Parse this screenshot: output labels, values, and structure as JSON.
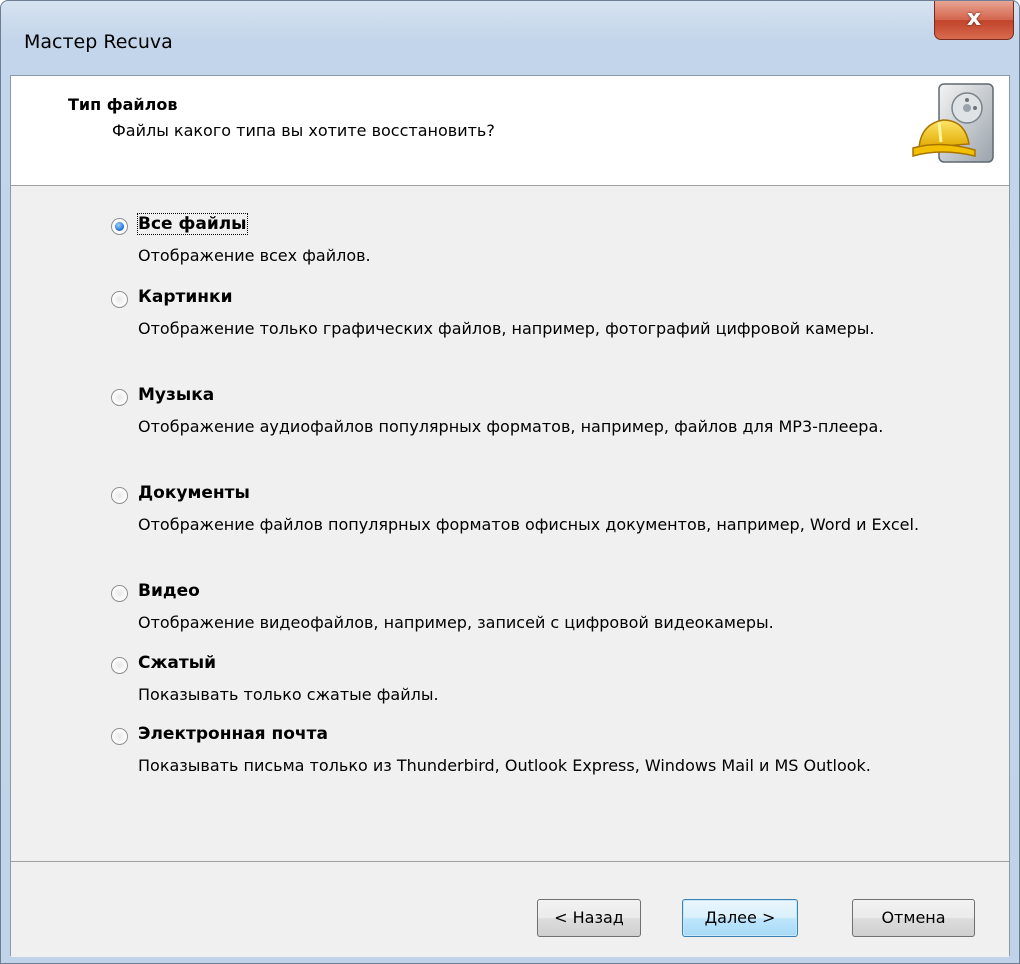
{
  "window": {
    "title": "Мастер Recuva",
    "close_label": "x"
  },
  "header": {
    "title": "Тип файлов",
    "subtitle": "Файлы какого типа вы хотите восстановить?",
    "icon": "hard-drive-hardhat-icon"
  },
  "options": [
    {
      "label": "Все файлы",
      "description": "Отображение всех файлов.",
      "checked": true
    },
    {
      "label": "Картинки",
      "description": "Отображение только графических файлов, например, фотографий цифровой камеры.",
      "checked": false
    },
    {
      "label": "Музыка",
      "description": "Отображение аудиофайлов популярных форматов, например, файлов для MP3-плеера.",
      "checked": false
    },
    {
      "label": "Документы",
      "description": "Отображение файлов популярных форматов офисных документов, например, Word и Excel.",
      "checked": false
    },
    {
      "label": "Видео",
      "description": "Отображение видеофайлов, например, записей с цифровой видеокамеры.",
      "checked": false
    },
    {
      "label": "Сжатый",
      "description": "Показывать только сжатые файлы.",
      "checked": false
    },
    {
      "label": "Электронная почта",
      "description": "Показывать письма только из Thunderbird, Outlook Express, Windows Mail и MS Outlook.",
      "checked": false
    }
  ],
  "buttons": {
    "back": "< Назад",
    "next": "Далее >",
    "cancel": "Отмена"
  },
  "colors": {
    "accent": "#1d6bd1",
    "close": "#c0432a"
  }
}
